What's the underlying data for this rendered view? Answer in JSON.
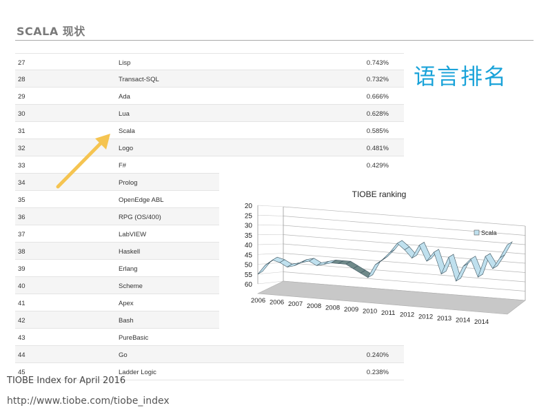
{
  "slide": {
    "title": "SCALA 现状",
    "heading": "语言排名",
    "caption": "TIOBE Index for April 2016",
    "url": "http://www.tiobe.com/tiobe_index"
  },
  "table": {
    "rows": [
      {
        "rank": "27",
        "language": "Lisp",
        "rating": "0.743%"
      },
      {
        "rank": "28",
        "language": "Transact-SQL",
        "rating": "0.732%"
      },
      {
        "rank": "29",
        "language": "Ada",
        "rating": "0.666%"
      },
      {
        "rank": "30",
        "language": "Lua",
        "rating": "0.628%"
      },
      {
        "rank": "31",
        "language": "Scala",
        "rating": "0.585%"
      },
      {
        "rank": "32",
        "language": "Logo",
        "rating": "0.481%"
      },
      {
        "rank": "33",
        "language": "F#",
        "rating": "0.429%"
      },
      {
        "rank": "34",
        "language": "Prolog",
        "rating": ""
      },
      {
        "rank": "35",
        "language": "OpenEdge ABL",
        "rating": ""
      },
      {
        "rank": "36",
        "language": "RPG (OS/400)",
        "rating": ""
      },
      {
        "rank": "37",
        "language": "LabVIEW",
        "rating": ""
      },
      {
        "rank": "38",
        "language": "Haskell",
        "rating": ""
      },
      {
        "rank": "39",
        "language": "Erlang",
        "rating": ""
      },
      {
        "rank": "40",
        "language": "Scheme",
        "rating": ""
      },
      {
        "rank": "41",
        "language": "Apex",
        "rating": ""
      },
      {
        "rank": "42",
        "language": "Bash",
        "rating": ""
      },
      {
        "rank": "43",
        "language": "PureBasic",
        "rating": ""
      },
      {
        "rank": "44",
        "language": "Go",
        "rating": "0.240%"
      },
      {
        "rank": "45",
        "language": "Ladder Logic",
        "rating": "0.238%"
      }
    ]
  },
  "colors": {
    "accent": "#1aa3d9",
    "arrow": "#f5c451",
    "series_fill": "#bfe0ee",
    "series_dark": "#6f8a8a",
    "floor": "#c8c8c8"
  },
  "chart_data": {
    "type": "area",
    "title": "TIOBE ranking",
    "legend": [
      "Scala"
    ],
    "legend_position": "right",
    "x_tick_labels": [
      "2006",
      "2006",
      "2007",
      "2008",
      "2008",
      "2009",
      "2010",
      "2011",
      "2012",
      "2012",
      "2013",
      "2014",
      "2014"
    ],
    "y_tick_labels": [
      "20",
      "25",
      "30",
      "35",
      "40",
      "45",
      "50",
      "55",
      "60"
    ],
    "ylim": [
      60,
      20
    ],
    "y_inverted": true,
    "grid": true,
    "three_d": true,
    "series": [
      {
        "name": "Scala",
        "values": [
          55,
          50,
          47,
          48,
          50,
          49,
          47,
          46,
          48,
          47,
          46,
          46,
          46,
          48,
          50,
          52,
          45,
          42,
          38,
          33,
          36,
          40,
          33,
          41,
          36,
          47,
          38,
          50,
          42,
          38,
          47,
          36,
          42,
          36,
          29
        ]
      }
    ]
  }
}
